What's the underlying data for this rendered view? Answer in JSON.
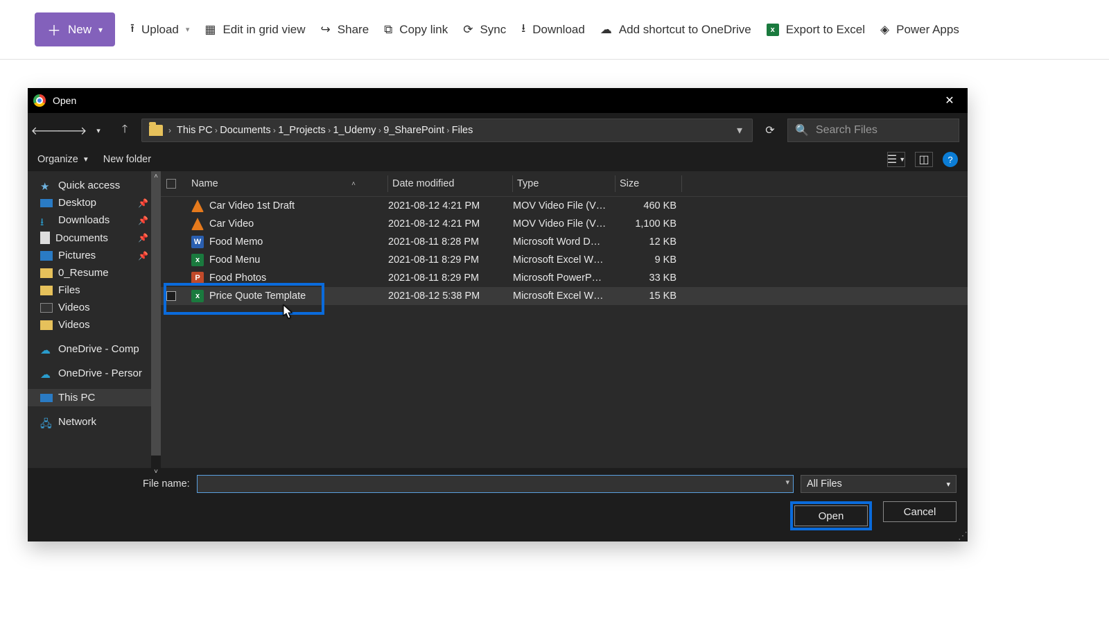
{
  "sharepoint": {
    "new": "New",
    "upload": "Upload",
    "editGrid": "Edit in grid view",
    "share": "Share",
    "copyLink": "Copy link",
    "sync": "Sync",
    "download": "Download",
    "shortcut": "Add shortcut to OneDrive",
    "exportExcel": "Export to Excel",
    "powerApps": "Power Apps"
  },
  "dialog": {
    "title": "Open",
    "breadcrumb": [
      "This PC",
      "Documents",
      "1_Projects",
      "1_Udemy",
      "9_SharePoint",
      "Files"
    ],
    "searchPlaceholder": "Search Files",
    "organize": "Organize",
    "newFolder": "New folder",
    "columns": {
      "name": "Name",
      "date": "Date modified",
      "type": "Type",
      "size": "Size"
    },
    "fileNameLabel": "File name:",
    "fileNameValue": "",
    "filter": "All Files",
    "openBtn": "Open",
    "cancelBtn": "Cancel"
  },
  "sidebar": [
    {
      "label": "Quick access",
      "icon": "star"
    },
    {
      "label": "Desktop",
      "icon": "desktop",
      "pinned": true
    },
    {
      "label": "Downloads",
      "icon": "down",
      "pinned": true
    },
    {
      "label": "Documents",
      "icon": "doc",
      "pinned": true
    },
    {
      "label": "Pictures",
      "icon": "pic",
      "pinned": true
    },
    {
      "label": "0_Resume",
      "icon": "folder"
    },
    {
      "label": "Files",
      "icon": "folder"
    },
    {
      "label": "Videos",
      "icon": "video"
    },
    {
      "label": "Videos",
      "icon": "folder"
    },
    {
      "label": "OneDrive - Comp",
      "icon": "cloud"
    },
    {
      "label": "OneDrive - Persor",
      "icon": "cloud"
    },
    {
      "label": "This PC",
      "icon": "pc",
      "selected": true
    },
    {
      "label": "Network",
      "icon": "net"
    }
  ],
  "files": [
    {
      "name": "Car Video 1st Draft",
      "date": "2021-08-12 4:21 PM",
      "type": "MOV Video File (V…",
      "size": "460 KB",
      "icon": "vlc"
    },
    {
      "name": "Car Video",
      "date": "2021-08-12 4:21 PM",
      "type": "MOV Video File (V…",
      "size": "1,100 KB",
      "icon": "vlc"
    },
    {
      "name": "Food Memo",
      "date": "2021-08-11 8:28 PM",
      "type": "Microsoft Word D…",
      "size": "12 KB",
      "icon": "word"
    },
    {
      "name": "Food Menu",
      "date": "2021-08-11 8:29 PM",
      "type": "Microsoft Excel W…",
      "size": "9 KB",
      "icon": "excel"
    },
    {
      "name": "Food Photos",
      "date": "2021-08-11 8:29 PM",
      "type": "Microsoft PowerP…",
      "size": "33 KB",
      "icon": "ppt"
    },
    {
      "name": "Price Quote Template",
      "date": "2021-08-12 5:38 PM",
      "type": "Microsoft Excel W…",
      "size": "15 KB",
      "icon": "excel",
      "selected": true
    }
  ]
}
